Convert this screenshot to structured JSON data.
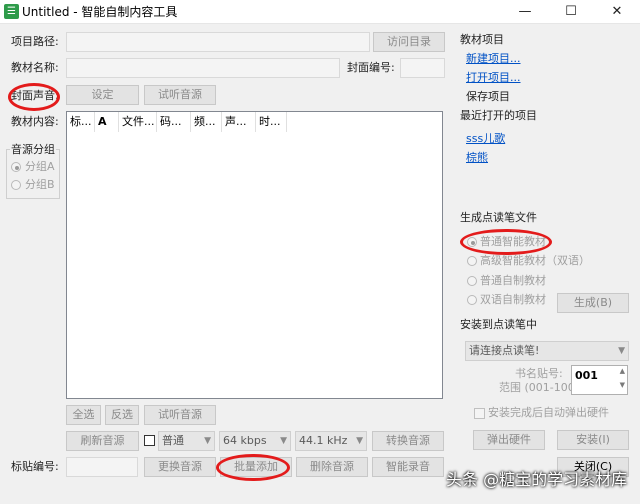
{
  "window": {
    "title": "Untitled - 智能自制内容工具",
    "app_icon_glyph": "☰",
    "minimize": "—",
    "maximize": "☐",
    "close": "✕"
  },
  "form": {
    "project_path_label": "项目路径:",
    "visit_dir_button": "访问目录",
    "textbook_name_label": "教材名称:",
    "cover_number_label": "封面编号:",
    "cover_sound_label": "封面声音:",
    "set_button": "设定",
    "preview_audio_button": "试听音源",
    "content_label": "教材内容:"
  },
  "audio_group": {
    "title": "音源分组",
    "options": [
      "分组A",
      "分组B"
    ]
  },
  "content_table": {
    "columns": [
      "标...",
      "A",
      "文件...",
      "码...",
      "频...",
      "声...",
      "时..."
    ]
  },
  "list_buttons": {
    "select_all": "全选",
    "invert": "反选",
    "preview": "试听音源",
    "refresh": "刷新音源",
    "quality": "普通",
    "bitrate": "64 kbps",
    "sample_rate": "44.1 kHz",
    "convert": "转换音源",
    "sticker_label": "标贴编号:",
    "replace": "更换音源",
    "batch_add": "批量添加",
    "delete": "删除音源",
    "smart_record": "智能录音"
  },
  "sidebar": {
    "project_title": "教材项目",
    "new_project": "新建项目...",
    "open_project": "打开项目...",
    "save_project": "保存项目",
    "recent_title": "最近打开的项目",
    "recent_items": [
      "sss儿歌",
      "棕熊"
    ]
  },
  "generate": {
    "title": "生成点读笔文件",
    "options": [
      "普通智能教材",
      "高级智能教材（双语）",
      "普通自制教材",
      "双语自制教材"
    ],
    "generate_button": "生成(B)"
  },
  "install": {
    "title": "安装到点读笔中",
    "pen_select": "请连接点读笔!",
    "book_sticker_label": "书名贴号:",
    "book_sticker_value": "001",
    "range_label": "范围 (001-100)",
    "auto_eject_label": "安装完成后自动弹出硬件",
    "eject_button": "弹出硬件",
    "install_button": "安装(I)",
    "close_button": "关闭(C)"
  },
  "watermark": "头条 @糖宝的学习素材库"
}
